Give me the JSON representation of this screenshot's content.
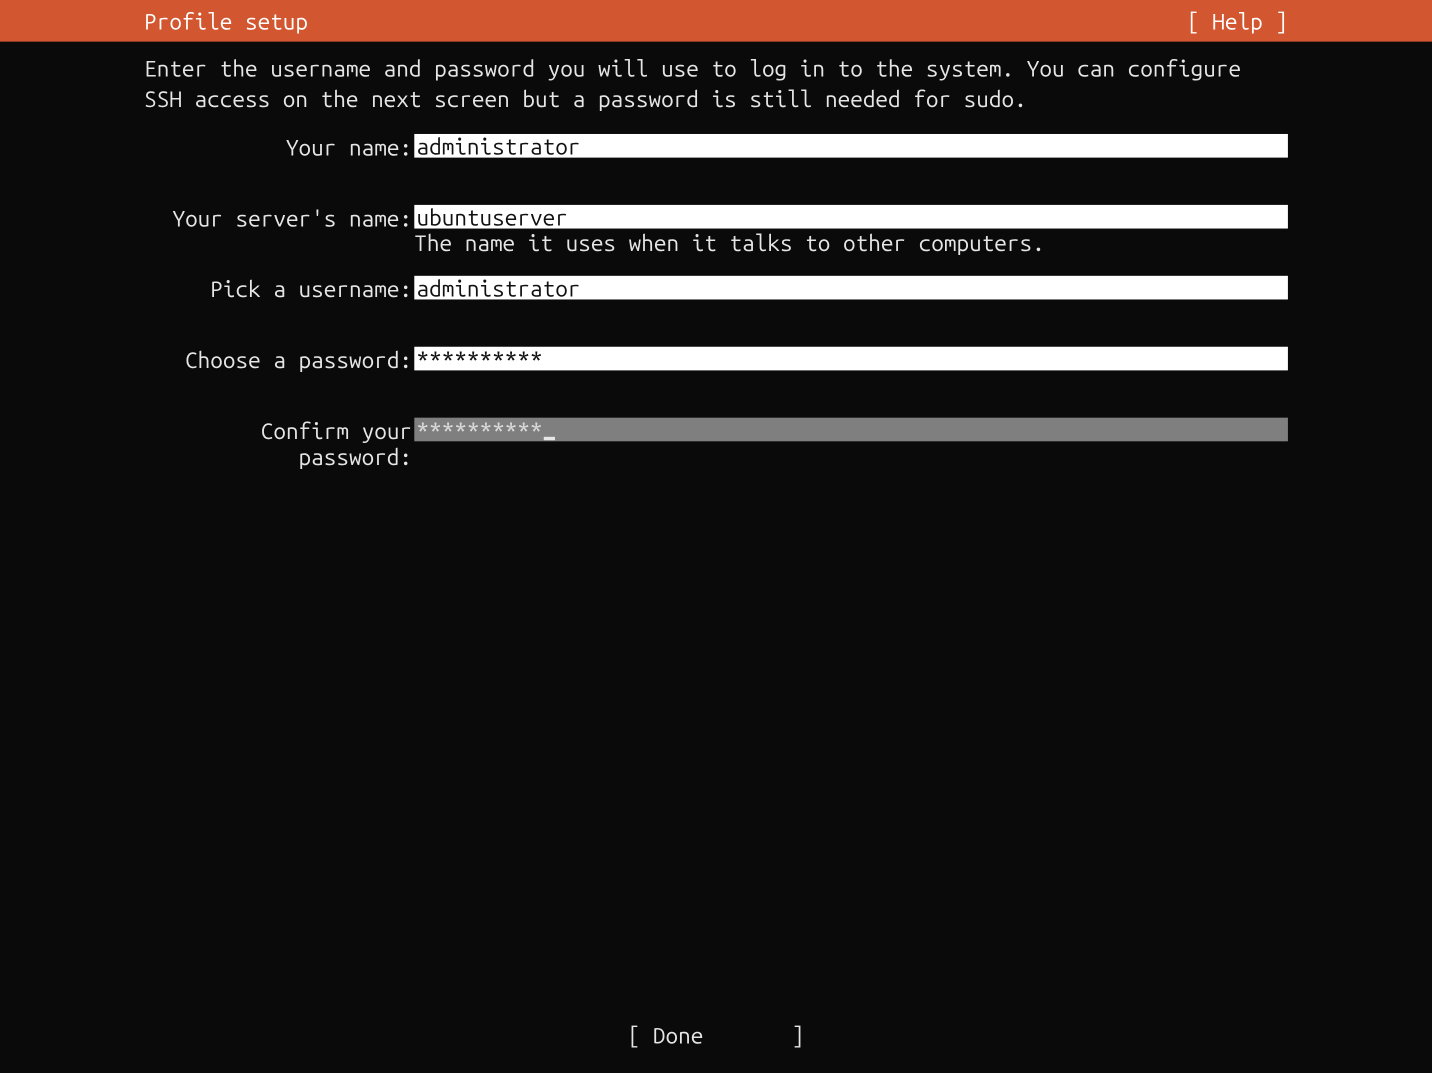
{
  "header": {
    "title": "Profile setup",
    "help": "[ Help ]"
  },
  "intro": "Enter the username and password you will use to log in to the system. You can configure SSH access on the next screen but a password is still needed for sudo.",
  "fields": {
    "name": {
      "label": "Your name:",
      "value": "administrator"
    },
    "server": {
      "label": "Your server's name:",
      "value": "ubuntuserver",
      "hint": "The name it uses when it talks to other computers."
    },
    "username": {
      "label": "Pick a username:",
      "value": "administrator"
    },
    "password": {
      "label": "Choose a password:",
      "value": "**********"
    },
    "confirm": {
      "label": "Confirm your password:",
      "value": "**********"
    }
  },
  "footer": {
    "done_open": "[ ",
    "done_label": "Done",
    "done_close": "       ]"
  }
}
